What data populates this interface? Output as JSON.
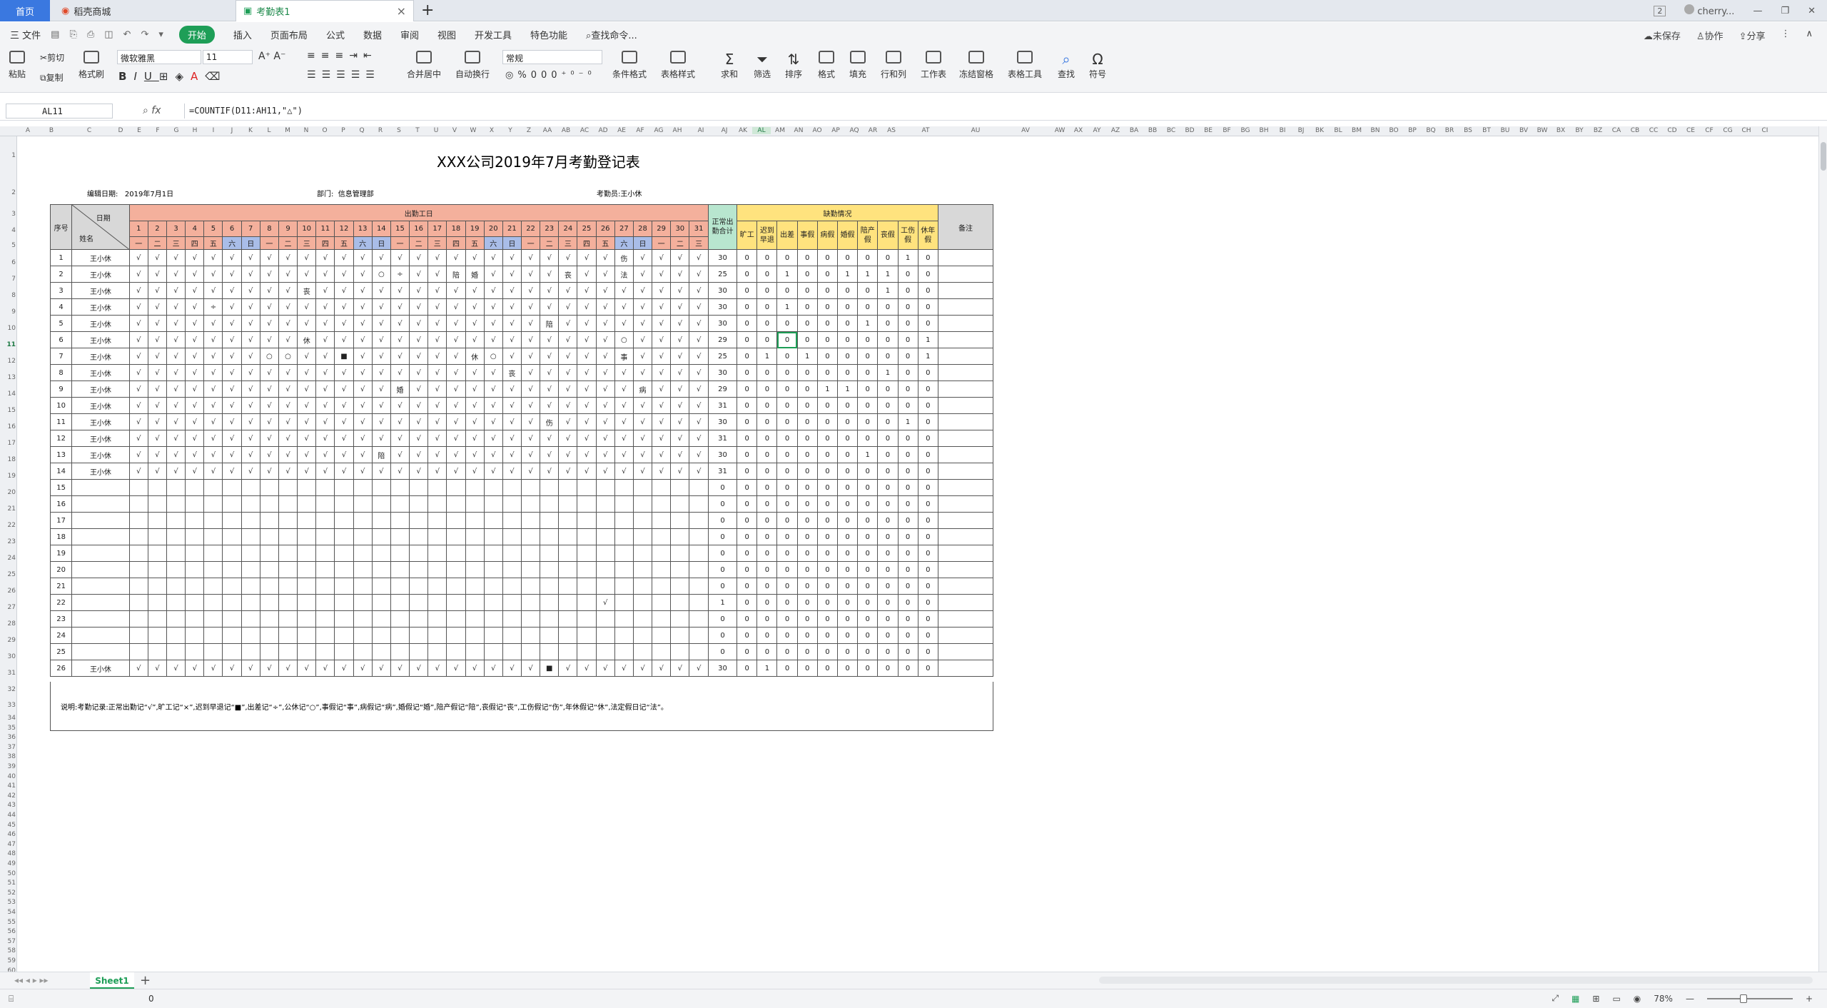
{
  "app": {
    "tabs": [
      {
        "label": "首页"
      },
      {
        "label": "稻壳商城"
      },
      {
        "label": "考勤表1"
      }
    ],
    "tab_count": "2",
    "user": "cherry..."
  },
  "menu": {
    "file": "三 文件",
    "items": [
      "开始",
      "插入",
      "页面布局",
      "公式",
      "数据",
      "审阅",
      "视图",
      "开发工具",
      "特色功能"
    ],
    "search": "查找命令...",
    "right": [
      "未保存",
      "协作",
      "分享"
    ]
  },
  "ribbon": {
    "paste": "粘贴",
    "cut": "剪切",
    "copy": "复制",
    "format_painter": "格式刷",
    "font_name": "微软雅黑",
    "font_size": "11",
    "num_format": "常规",
    "merge": "合并居中",
    "wrap": "自动换行",
    "cond": "条件格式",
    "table_style": "表格样式",
    "sum": "求和",
    "filter": "筛选",
    "sort": "排序",
    "format": "格式",
    "fill": "填充",
    "rowcol": "行和列",
    "worksheet": "工作表",
    "freeze": "冻结窗格",
    "tools": "表格工具",
    "find": "查找",
    "symbol": "符号"
  },
  "formula_bar": {
    "cell_ref": "AL11",
    "formula": "=COUNTIF(D11:AH11,\"△\")"
  },
  "columns": [
    "A",
    "B",
    "C",
    "D",
    "E",
    "F",
    "G",
    "H",
    "I",
    "J",
    "K",
    "L",
    "M",
    "N",
    "O",
    "P",
    "Q",
    "R",
    "S",
    "T",
    "U",
    "V",
    "W",
    "X",
    "Y",
    "Z",
    "AA",
    "AB",
    "AC",
    "AD",
    "AE",
    "AF",
    "AG",
    "AH",
    "AI",
    "AJ",
    "AK",
    "AL",
    "AM",
    "AN",
    "AO",
    "AP",
    "AQ",
    "AR",
    "AS",
    "AT",
    "AU",
    "AV",
    "AW",
    "AX",
    "AY",
    "AZ",
    "BA",
    "BB",
    "BC",
    "BD",
    "BE",
    "BF",
    "BG",
    "BH",
    "BI",
    "BJ",
    "BK",
    "BL",
    "BM",
    "BN",
    "BO",
    "BP",
    "BQ",
    "BR",
    "BS",
    "BT",
    "BU",
    "BV",
    "BW",
    "BX",
    "BY",
    "BZ",
    "CA",
    "CB",
    "CC",
    "CD",
    "CE",
    "CF",
    "CG",
    "CH",
    "CI"
  ],
  "sheet": {
    "title": "XXX公司2019年7月考勤登记表",
    "edit_date_label": "编辑日期:",
    "edit_date": "2019年7月1日",
    "dept_label": "部门:",
    "dept": "信息管理部",
    "clerk_label": "考勤员:",
    "clerk": "王小休",
    "h_seq": "序号",
    "h_date": "日期",
    "h_name": "姓名",
    "h_workdays": "出勤工日",
    "h_normal": "正常出勤合计",
    "h_absence": "缺勤情况",
    "h_remark": "备注",
    "absence_cols": [
      "旷工",
      "迟到早退",
      "出差",
      "事假",
      "病假",
      "婚假",
      "陪产假",
      "丧假",
      "工伤假",
      "休年假"
    ],
    "days": [
      "1",
      "2",
      "3",
      "4",
      "5",
      "6",
      "7",
      "8",
      "9",
      "10",
      "11",
      "12",
      "13",
      "14",
      "15",
      "16",
      "17",
      "18",
      "19",
      "20",
      "21",
      "22",
      "23",
      "24",
      "25",
      "26",
      "27",
      "28",
      "29",
      "30",
      "31"
    ],
    "weekdays": [
      "一",
      "二",
      "三",
      "四",
      "五",
      "六",
      "日",
      "一",
      "二",
      "三",
      "四",
      "五",
      "六",
      "日",
      "一",
      "二",
      "三",
      "四",
      "五",
      "六",
      "日",
      "一",
      "二",
      "三",
      "四",
      "五",
      "六",
      "日",
      "一",
      "二",
      "三"
    ],
    "note": "说明:考勤记录:正常出勤记“√”,旷工记“×”,迟到早退记“■”,出差记“÷”,公休记“○”,事假记“事”,病假记“病”,婚假记“婚”,陪产假记“陪”,丧假记“丧”,工伤假记“伤”,年休假记“休”,法定假日记“法”。",
    "rows": [
      {
        "seq": "1",
        "name": "王小休",
        "marks": [
          "√",
          "√",
          "√",
          "√",
          "√",
          "√",
          "√",
          "√",
          "√",
          "√",
          "√",
          "√",
          "√",
          "√",
          "√",
          "√",
          "√",
          "√",
          "√",
          "√",
          "√",
          "√",
          "√",
          "√",
          "√",
          "√",
          "伤",
          "√",
          "√",
          "√",
          "√"
        ],
        "total": "30",
        "abs": [
          "0",
          "0",
          "0",
          "0",
          "0",
          "0",
          "0",
          "0",
          "1",
          "0"
        ]
      },
      {
        "seq": "2",
        "name": "王小休",
        "marks": [
          "√",
          "√",
          "√",
          "√",
          "√",
          "√",
          "√",
          "√",
          "√",
          "√",
          "√",
          "√",
          "√",
          "○",
          "÷",
          "√",
          "√",
          "陪",
          "婚",
          "√",
          "√",
          "√",
          "√",
          "丧",
          "√",
          "√",
          "法",
          "√",
          "√",
          "√",
          "√"
        ],
        "total": "25",
        "abs": [
          "0",
          "0",
          "1",
          "0",
          "0",
          "1",
          "1",
          "1",
          "0",
          "0"
        ]
      },
      {
        "seq": "3",
        "name": "王小休",
        "marks": [
          "√",
          "√",
          "√",
          "√",
          "√",
          "√",
          "√",
          "√",
          "√",
          "丧",
          "√",
          "√",
          "√",
          "√",
          "√",
          "√",
          "√",
          "√",
          "√",
          "√",
          "√",
          "√",
          "√",
          "√",
          "√",
          "√",
          "√",
          "√",
          "√",
          "√",
          "√"
        ],
        "total": "30",
        "abs": [
          "0",
          "0",
          "0",
          "0",
          "0",
          "0",
          "0",
          "1",
          "0",
          "0"
        ]
      },
      {
        "seq": "4",
        "name": "王小休",
        "marks": [
          "√",
          "√",
          "√",
          "√",
          "÷",
          "√",
          "√",
          "√",
          "√",
          "√",
          "√",
          "√",
          "√",
          "√",
          "√",
          "√",
          "√",
          "√",
          "√",
          "√",
          "√",
          "√",
          "√",
          "√",
          "√",
          "√",
          "√",
          "√",
          "√",
          "√",
          "√"
        ],
        "total": "30",
        "abs": [
          "0",
          "0",
          "1",
          "0",
          "0",
          "0",
          "0",
          "0",
          "0",
          "0"
        ]
      },
      {
        "seq": "5",
        "name": "王小休",
        "marks": [
          "√",
          "√",
          "√",
          "√",
          "√",
          "√",
          "√",
          "√",
          "√",
          "√",
          "√",
          "√",
          "√",
          "√",
          "√",
          "√",
          "√",
          "√",
          "√",
          "√",
          "√",
          "√",
          "陪",
          "√",
          "√",
          "√",
          "√",
          "√",
          "√",
          "√",
          "√"
        ],
        "total": "30",
        "abs": [
          "0",
          "0",
          "0",
          "0",
          "0",
          "0",
          "1",
          "0",
          "0",
          "0"
        ]
      },
      {
        "seq": "6",
        "name": "王小休",
        "marks": [
          "√",
          "√",
          "√",
          "√",
          "√",
          "√",
          "√",
          "√",
          "√",
          "休",
          "√",
          "√",
          "√",
          "√",
          "√",
          "√",
          "√",
          "√",
          "√",
          "√",
          "√",
          "√",
          "√",
          "√",
          "√",
          "√",
          "○",
          "√",
          "√",
          "√",
          "√"
        ],
        "total": "29",
        "abs": [
          "0",
          "0",
          "0",
          "0",
          "0",
          "0",
          "0",
          "0",
          "0",
          "1"
        ]
      },
      {
        "seq": "7",
        "name": "王小休",
        "marks": [
          "√",
          "√",
          "√",
          "√",
          "√",
          "√",
          "√",
          "○",
          "○",
          "√",
          "√",
          "■",
          "√",
          "√",
          "√",
          "√",
          "√",
          "√",
          "休",
          "○",
          "√",
          "√",
          "√",
          "√",
          "√",
          "√",
          "事",
          "√",
          "√",
          "√",
          "√"
        ],
        "total": "25",
        "abs": [
          "0",
          "1",
          "0",
          "1",
          "0",
          "0",
          "0",
          "0",
          "0",
          "1"
        ]
      },
      {
        "seq": "8",
        "name": "王小休",
        "marks": [
          "√",
          "√",
          "√",
          "√",
          "√",
          "√",
          "√",
          "√",
          "√",
          "√",
          "√",
          "√",
          "√",
          "√",
          "√",
          "√",
          "√",
          "√",
          "√",
          "√",
          "丧",
          "√",
          "√",
          "√",
          "√",
          "√",
          "√",
          "√",
          "√",
          "√",
          "√"
        ],
        "total": "30",
        "abs": [
          "0",
          "0",
          "0",
          "0",
          "0",
          "0",
          "0",
          "1",
          "0",
          "0"
        ]
      },
      {
        "seq": "9",
        "name": "王小休",
        "marks": [
          "√",
          "√",
          "√",
          "√",
          "√",
          "√",
          "√",
          "√",
          "√",
          "√",
          "√",
          "√",
          "√",
          "√",
          "婚",
          "√",
          "√",
          "√",
          "√",
          "√",
          "√",
          "√",
          "√",
          "√",
          "√",
          "√",
          "√",
          "病",
          "√",
          "√",
          "√"
        ],
        "total": "29",
        "abs": [
          "0",
          "0",
          "0",
          "0",
          "1",
          "1",
          "0",
          "0",
          "0",
          "0"
        ]
      },
      {
        "seq": "10",
        "name": "王小休",
        "marks": [
          "√",
          "√",
          "√",
          "√",
          "√",
          "√",
          "√",
          "√",
          "√",
          "√",
          "√",
          "√",
          "√",
          "√",
          "√",
          "√",
          "√",
          "√",
          "√",
          "√",
          "√",
          "√",
          "√",
          "√",
          "√",
          "√",
          "√",
          "√",
          "√",
          "√",
          "√"
        ],
        "total": "31",
        "abs": [
          "0",
          "0",
          "0",
          "0",
          "0",
          "0",
          "0",
          "0",
          "0",
          "0"
        ]
      },
      {
        "seq": "11",
        "name": "王小休",
        "marks": [
          "√",
          "√",
          "√",
          "√",
          "√",
          "√",
          "√",
          "√",
          "√",
          "√",
          "√",
          "√",
          "√",
          "√",
          "√",
          "√",
          "√",
          "√",
          "√",
          "√",
          "√",
          "√",
          "伤",
          "√",
          "√",
          "√",
          "√",
          "√",
          "√",
          "√",
          "√"
        ],
        "total": "30",
        "abs": [
          "0",
          "0",
          "0",
          "0",
          "0",
          "0",
          "0",
          "0",
          "1",
          "0"
        ]
      },
      {
        "seq": "12",
        "name": "王小休",
        "marks": [
          "√",
          "√",
          "√",
          "√",
          "√",
          "√",
          "√",
          "√",
          "√",
          "√",
          "√",
          "√",
          "√",
          "√",
          "√",
          "√",
          "√",
          "√",
          "√",
          "√",
          "√",
          "√",
          "√",
          "√",
          "√",
          "√",
          "√",
          "√",
          "√",
          "√",
          "√"
        ],
        "total": "31",
        "abs": [
          "0",
          "0",
          "0",
          "0",
          "0",
          "0",
          "0",
          "0",
          "0",
          "0"
        ]
      },
      {
        "seq": "13",
        "name": "王小休",
        "marks": [
          "√",
          "√",
          "√",
          "√",
          "√",
          "√",
          "√",
          "√",
          "√",
          "√",
          "√",
          "√",
          "√",
          "陪",
          "√",
          "√",
          "√",
          "√",
          "√",
          "√",
          "√",
          "√",
          "√",
          "√",
          "√",
          "√",
          "√",
          "√",
          "√",
          "√",
          "√"
        ],
        "total": "30",
        "abs": [
          "0",
          "0",
          "0",
          "0",
          "0",
          "0",
          "1",
          "0",
          "0",
          "0"
        ]
      },
      {
        "seq": "14",
        "name": "王小休",
        "marks": [
          "√",
          "√",
          "√",
          "√",
          "√",
          "√",
          "√",
          "√",
          "√",
          "√",
          "√",
          "√",
          "√",
          "√",
          "√",
          "√",
          "√",
          "√",
          "√",
          "√",
          "√",
          "√",
          "√",
          "√",
          "√",
          "√",
          "√",
          "√",
          "√",
          "√",
          "√"
        ],
        "total": "31",
        "abs": [
          "0",
          "0",
          "0",
          "0",
          "0",
          "0",
          "0",
          "0",
          "0",
          "0"
        ]
      },
      {
        "seq": "15",
        "name": "",
        "marks": [],
        "total": "0",
        "abs": [
          "0",
          "0",
          "0",
          "0",
          "0",
          "0",
          "0",
          "0",
          "0",
          "0"
        ]
      },
      {
        "seq": "16",
        "name": "",
        "marks": [],
        "total": "0",
        "abs": [
          "0",
          "0",
          "0",
          "0",
          "0",
          "0",
          "0",
          "0",
          "0",
          "0"
        ]
      },
      {
        "seq": "17",
        "name": "",
        "marks": [],
        "total": "0",
        "abs": [
          "0",
          "0",
          "0",
          "0",
          "0",
          "0",
          "0",
          "0",
          "0",
          "0"
        ]
      },
      {
        "seq": "18",
        "name": "",
        "marks": [],
        "total": "0",
        "abs": [
          "0",
          "0",
          "0",
          "0",
          "0",
          "0",
          "0",
          "0",
          "0",
          "0"
        ]
      },
      {
        "seq": "19",
        "name": "",
        "marks": [],
        "total": "0",
        "abs": [
          "0",
          "0",
          "0",
          "0",
          "0",
          "0",
          "0",
          "0",
          "0",
          "0"
        ]
      },
      {
        "seq": "20",
        "name": "",
        "marks": [],
        "total": "0",
        "abs": [
          "0",
          "0",
          "0",
          "0",
          "0",
          "0",
          "0",
          "0",
          "0",
          "0"
        ]
      },
      {
        "seq": "21",
        "name": "",
        "marks": [],
        "total": "0",
        "abs": [
          "0",
          "0",
          "0",
          "0",
          "0",
          "0",
          "0",
          "0",
          "0",
          "0"
        ]
      },
      {
        "seq": "22",
        "name": "",
        "marks": [
          "",
          "",
          "",
          "",
          "",
          "",
          "",
          "",
          "",
          "",
          "",
          "",
          "",
          "",
          "",
          "",
          "",
          "",
          "",
          "",
          "",
          "",
          "",
          "",
          "",
          "√"
        ],
        "total": "1",
        "abs": [
          "0",
          "0",
          "0",
          "0",
          "0",
          "0",
          "0",
          "0",
          "0",
          "0"
        ]
      },
      {
        "seq": "23",
        "name": "",
        "marks": [],
        "total": "0",
        "abs": [
          "0",
          "0",
          "0",
          "0",
          "0",
          "0",
          "0",
          "0",
          "0",
          "0"
        ]
      },
      {
        "seq": "24",
        "name": "",
        "marks": [],
        "total": "0",
        "abs": [
          "0",
          "0",
          "0",
          "0",
          "0",
          "0",
          "0",
          "0",
          "0",
          "0"
        ]
      },
      {
        "seq": "25",
        "name": "",
        "marks": [],
        "total": "0",
        "abs": [
          "0",
          "0",
          "0",
          "0",
          "0",
          "0",
          "0",
          "0",
          "0",
          "0"
        ]
      },
      {
        "seq": "26",
        "name": "王小休",
        "marks": [
          "√",
          "√",
          "√",
          "√",
          "√",
          "√",
          "√",
          "√",
          "√",
          "√",
          "√",
          "√",
          "√",
          "√",
          "√",
          "√",
          "√",
          "√",
          "√",
          "√",
          "√",
          "√",
          "■",
          "√",
          "√",
          "√",
          "√",
          "√",
          "√",
          "√",
          "√"
        ],
        "total": "30",
        "abs": [
          "0",
          "1",
          "0",
          "0",
          "0",
          "0",
          "0",
          "0",
          "0",
          "0"
        ]
      }
    ]
  },
  "sheet_tab": "Sheet1",
  "status": {
    "value": "0",
    "zoom": "78%"
  }
}
